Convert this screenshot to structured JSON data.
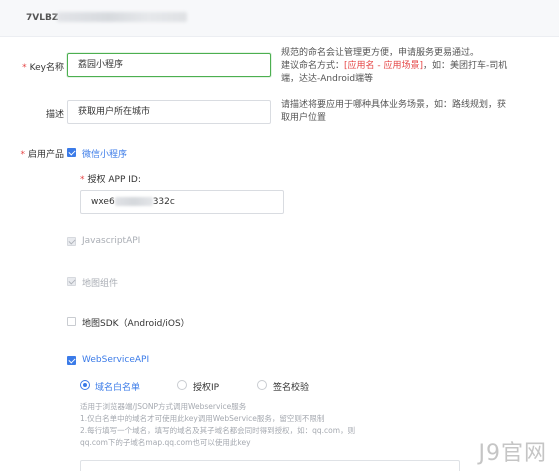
{
  "header": {
    "key_prefix": "7VLBZ"
  },
  "form": {
    "key_name": {
      "label": "Key名称",
      "value": "荔园小程序",
      "hint_line1": "规范的命名会让管理更方便，申请服务更易通过。",
      "hint_line2_a": "建议命名方式：",
      "hint_line2_red": "[应用名 - 应用场景]",
      "hint_line2_b": "，如：美团打车-司机",
      "hint_line3": "端，达达-Android端等"
    },
    "description": {
      "label": "描述",
      "value": "获取用户所在城市",
      "hint_line1": "请描述将要应用于哪种具体业务场景，如：路线规划，获",
      "hint_line2": "取用户位置"
    },
    "products": {
      "label": "启用产品",
      "mini_program": {
        "label": "微信小程序",
        "appid_label": "授权 APP ID:",
        "appid_prefix": "wxe6",
        "appid_suffix": "332c"
      },
      "javascript_api": "JavascriptAPI",
      "map_component": "地图组件",
      "map_sdk": "地图SDK（Android/iOS）",
      "webservice_api": {
        "label": "WebServiceAPI",
        "options": [
          "域名白名单",
          "授权IP",
          "签名校验"
        ],
        "desc_line1": "适用于浏览器端/JSONP方式调用Webservice服务",
        "desc_line2": "1.仅白名单中的域名才可使用此key调用WebService服务，留空则不限制",
        "desc_line3": "2.每行填写一个域名，填写的域名及其子域名都会同时得到授权，如：qq.com，则",
        "desc_line4": "qq.com下的子域名map.qq.com也可以使用此key"
      }
    }
  },
  "watermark": "J9官网",
  "colors": {
    "accent": "#3b7be8",
    "required": "#e54545",
    "focus": "#4caf50"
  }
}
